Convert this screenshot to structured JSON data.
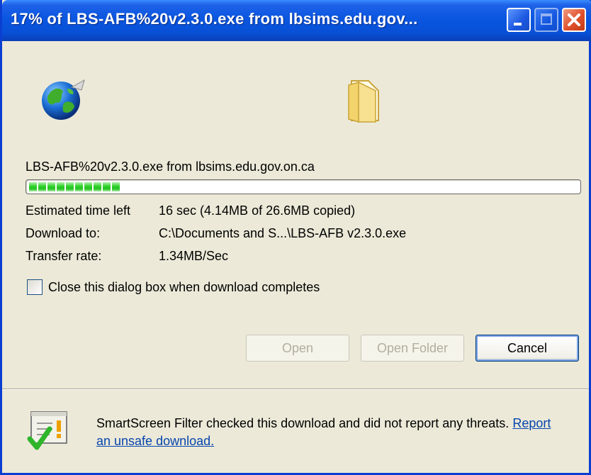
{
  "window": {
    "title": "17% of LBS-AFB%20v2.3.0.exe from lbsims.edu.gov...",
    "controls": [
      "minimize-icon",
      "maximize-icon",
      "close-icon"
    ]
  },
  "icons": {
    "source": "globe-icon",
    "destination": "folder-icon",
    "smartscreen": "smartscreen-check-icon"
  },
  "download": {
    "filename_source": "LBS-AFB%20v2.3.0.exe from lbsims.edu.gov.on.ca",
    "progress_fraction": 0.17,
    "details": [
      {
        "label": "Estimated time left",
        "value": "16 sec (4.14MB of 26.6MB copied)"
      },
      {
        "label": "Download to:",
        "value": "C:\\Documents and S...\\LBS-AFB v2.3.0.exe"
      },
      {
        "label": "Transfer rate:",
        "value": "1.34MB/Sec"
      }
    ]
  },
  "options": {
    "close_on_complete_label": "Close this dialog box when download completes",
    "close_on_complete_checked": false
  },
  "buttons": {
    "open": "Open",
    "open_folder": "Open Folder",
    "cancel": "Cancel"
  },
  "smartscreen": {
    "message": "SmartScreen Filter checked this download and did not report any threats.",
    "link": "Report an unsafe download."
  },
  "colors": {
    "title_bar": "#0a56e0",
    "progress_green": "#2fd12a",
    "dialog_bg": "#ece9d8",
    "link": "#0645ad"
  }
}
